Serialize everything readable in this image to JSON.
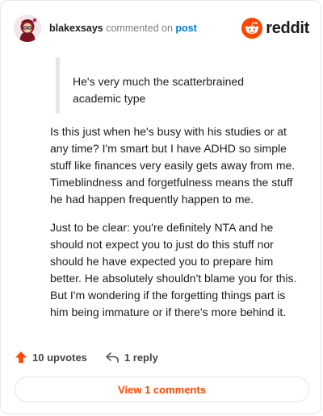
{
  "header": {
    "username": "blakexsays",
    "commented_on": "commented on",
    "post_link": "post",
    "brand": "reddit",
    "brand_color": "#ff4500",
    "avatar_icon": "user-avatar"
  },
  "comment": {
    "quote": "He's very much the scatterbrained academic type",
    "paragraphs": [
      "Is this just when he's busy with his studies or at any time? I'm smart but I have ADHD so simple stuff like finances very easily gets away from me. Timeblindness and forgetfulness means the stuff he had happen frequently happen to me.",
      "Just to be clear: you're definitely NTA and he should not expect you to just do this stuff nor should he have expected you to prepare him better. He absolutely shouldn't blame you for this. But I'm wondering if the forgetting things part is him being immature or if there's more behind it."
    ]
  },
  "actions": {
    "upvotes": "10 upvotes",
    "upvote_icon": "upvote-arrow-icon",
    "reply": "1 reply",
    "reply_icon": "reply-arrow-icon"
  },
  "footer": {
    "view_comments": "View 1 comments"
  }
}
